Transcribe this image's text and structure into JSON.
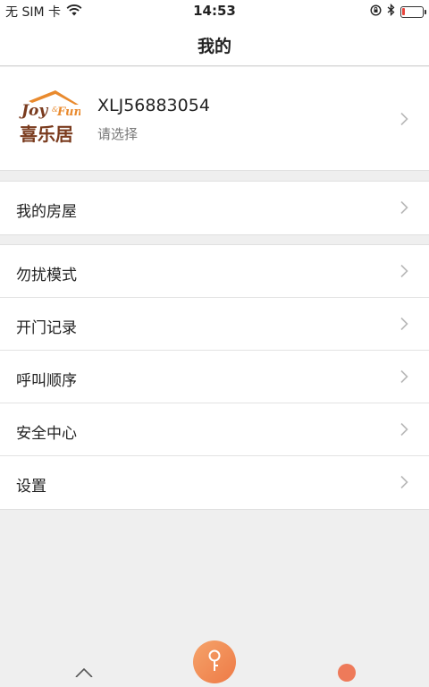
{
  "status": {
    "carrier": "无 SIM 卡",
    "time": "14:53",
    "battery_level": 0.15,
    "battery_color": "#e8453c"
  },
  "nav": {
    "title": "我的"
  },
  "profile": {
    "logo_text_en": "Joy&Fun",
    "logo_text_cn": "喜乐居",
    "username": "XLJ56883054",
    "subtitle": "请选择"
  },
  "groups": [
    {
      "items": [
        {
          "label": "我的房屋"
        }
      ]
    },
    {
      "items": [
        {
          "label": "勿扰模式"
        },
        {
          "label": "开门记录"
        },
        {
          "label": "呼叫顺序"
        },
        {
          "label": "安全中心"
        },
        {
          "label": "设置"
        }
      ]
    }
  ],
  "icons": {
    "chevron": "chevron-right-icon",
    "tab_center": "key-icon"
  },
  "colors": {
    "accent": "#ee7a46",
    "logo_brown": "#7a3b1e",
    "logo_orange": "#e98a2e"
  }
}
